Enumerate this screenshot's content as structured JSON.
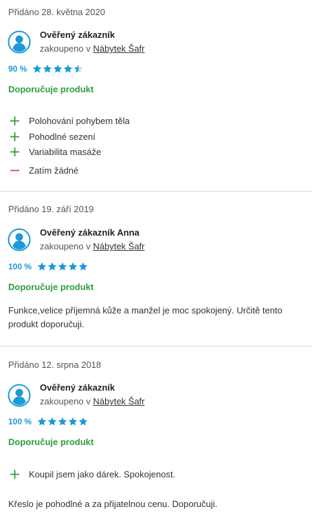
{
  "colors": {
    "accent_blue": "#1a9ad6",
    "recommend_green": "#2e9e3f",
    "pro_green": "#2e9e3f",
    "con_red": "#e0483c",
    "divider": "#d9d9d9"
  },
  "icons": {
    "avatar": "user-avatar-icon",
    "star": "star-icon",
    "pro": "plus-icon",
    "con": "minus-icon"
  },
  "reviews": [
    {
      "date": "Přidáno 28. května 2020",
      "author": "Ověřený zákazník",
      "purchased_prefix": "zakoupeno v",
      "shop": "Nábytek Šafr",
      "rating_label": "90 %",
      "rating_fraction": 0.9,
      "stars_filled": 4.5,
      "recommend": "Doporučuje produkt",
      "pros": [
        "Polohování pohybem těla",
        "Pohodlné sezení",
        "Variabilita masáže"
      ],
      "cons": [
        "Zatím žádné"
      ]
    },
    {
      "date": "Přidáno 19. září 2019",
      "author": "Ověřený zákazník Anna",
      "purchased_prefix": "zakoupeno v",
      "shop": "Nábytek Šafr",
      "rating_label": "100 %",
      "rating_fraction": 1.0,
      "stars_filled": 5,
      "recommend": "Doporučuje produkt",
      "text": "Funkce,velice příjemná kůže a manžel je moc spokojený. Určitě tento produkt doporučuji."
    },
    {
      "date": "Přidáno 12. srpna 2018",
      "author": "Ověřený zákazník",
      "purchased_prefix": "zakoupeno v",
      "shop": "Nábytek Šafr",
      "rating_label": "100 %",
      "rating_fraction": 1.0,
      "stars_filled": 5,
      "recommend": "Doporučuje produkt",
      "pros": [
        "Koupil jsem jako dárek. Spokojenost."
      ],
      "text": "Křeslo je pohodlné a za přijatelnou cenu. Doporučuji."
    }
  ]
}
